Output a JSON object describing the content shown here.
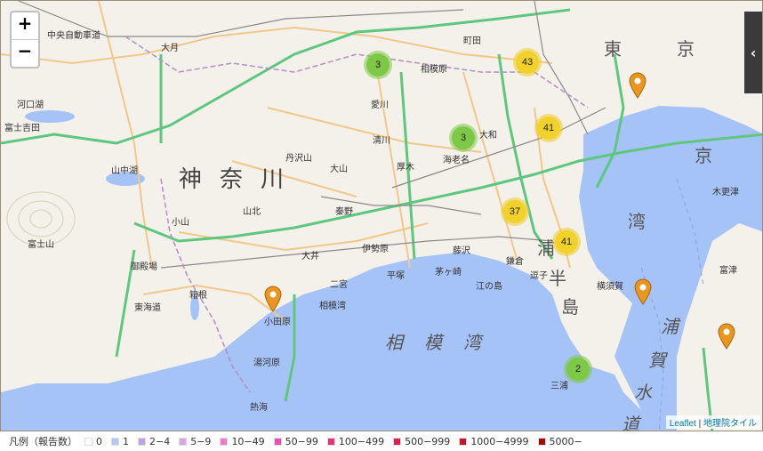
{
  "map": {
    "zoom_in": "+",
    "zoom_out": "−",
    "side_toggle": "‹",
    "attribution_link": "Leaflet",
    "attribution_sep": " | ",
    "attribution_source": "地理院タイル",
    "labels": {
      "kanagawa_1": "神",
      "kanagawa_2": "奈",
      "kanagawa_3": "川",
      "sagami_1": "相",
      "sagami_2": "模",
      "sagami_3": "湾",
      "tokyo_bay": "湾",
      "miura_1": "浦",
      "miura_2": "半",
      "miura_3": "島",
      "uraga_1": "浦",
      "uraga_2": "賀",
      "uraga_3": "水",
      "uraga_4": "道",
      "kyo": "京",
      "tokyo_1": "東",
      "tokyo_2": "京",
      "yamakita": "山北",
      "hadano": "秦野",
      "atsugi": "厚木",
      "ebina": "海老名",
      "yamato": "大和",
      "odawara": "小田原",
      "kamakura": "鎌倉",
      "enoshima": "江の島",
      "hakone": "箱根",
      "kiyokawa": "清川",
      "aikawa": "愛川",
      "sagamihara": "相模原",
      "fujisan": "富士山",
      "hiratsuka": "平塚",
      "chigasaki": "茅ヶ崎",
      "fujisawa": "藤沢",
      "zushi": "逗子",
      "yokosuka": "横須賀",
      "miura": "三浦",
      "ooi": "大井",
      "ninomiya": "二宮",
      "atami": "熱海",
      "yugawara": "湯河原",
      "futtsu": "富津",
      "kisarazu": "木更津",
      "oyama": "大山",
      "tanzawa": "丹沢山",
      "gotemba": "御殿場",
      "oyamacho": "小山",
      "kawaguchiko": "河口湖",
      "yamanakako": "山中湖",
      "fujiyoshida": "富士吉田",
      "otsuki": "大月",
      "kofu_e": "中央自動車道",
      "sagamiwan_bay": "相模湾",
      "isehara": "伊勢原",
      "machida": "町田",
      "tokaido": "東海道"
    },
    "clusters": [
      {
        "count": "3",
        "color": "#7ec848",
        "ring": "rgba(126,200,72,0.55)"
      },
      {
        "count": "43",
        "color": "#f0d22a",
        "ring": "rgba(240,200,40,0.55)"
      },
      {
        "count": "3",
        "color": "#7ec848",
        "ring": "rgba(126,200,72,0.55)"
      },
      {
        "count": "41",
        "color": "#f0d22a",
        "ring": "rgba(240,200,40,0.55)"
      },
      {
        "count": "37",
        "color": "#f0d22a",
        "ring": "rgba(240,200,40,0.55)"
      },
      {
        "count": "41",
        "color": "#f0d22a",
        "ring": "rgba(240,200,40,0.55)"
      },
      {
        "count": "2",
        "color": "#7ec848",
        "ring": "rgba(126,200,72,0.55)"
      }
    ],
    "pin_color": "#e8961e"
  },
  "legend": {
    "title": "凡例（報告数）",
    "items": [
      {
        "label": "0",
        "color": "#ffffff"
      },
      {
        "label": "1",
        "color": "#b5c6f0"
      },
      {
        "label": "2−4",
        "color": "#b9a6e0"
      },
      {
        "label": "5−9",
        "color": "#d9a6e0"
      },
      {
        "label": "10−49",
        "color": "#f07ac8"
      },
      {
        "label": "50−99",
        "color": "#f04cb0"
      },
      {
        "label": "100−499",
        "color": "#e8307a"
      },
      {
        "label": "500−999",
        "color": "#e01e50"
      },
      {
        "label": "1000−4999",
        "color": "#c81428"
      },
      {
        "label": "5000−",
        "color": "#a00a0a"
      }
    ]
  }
}
